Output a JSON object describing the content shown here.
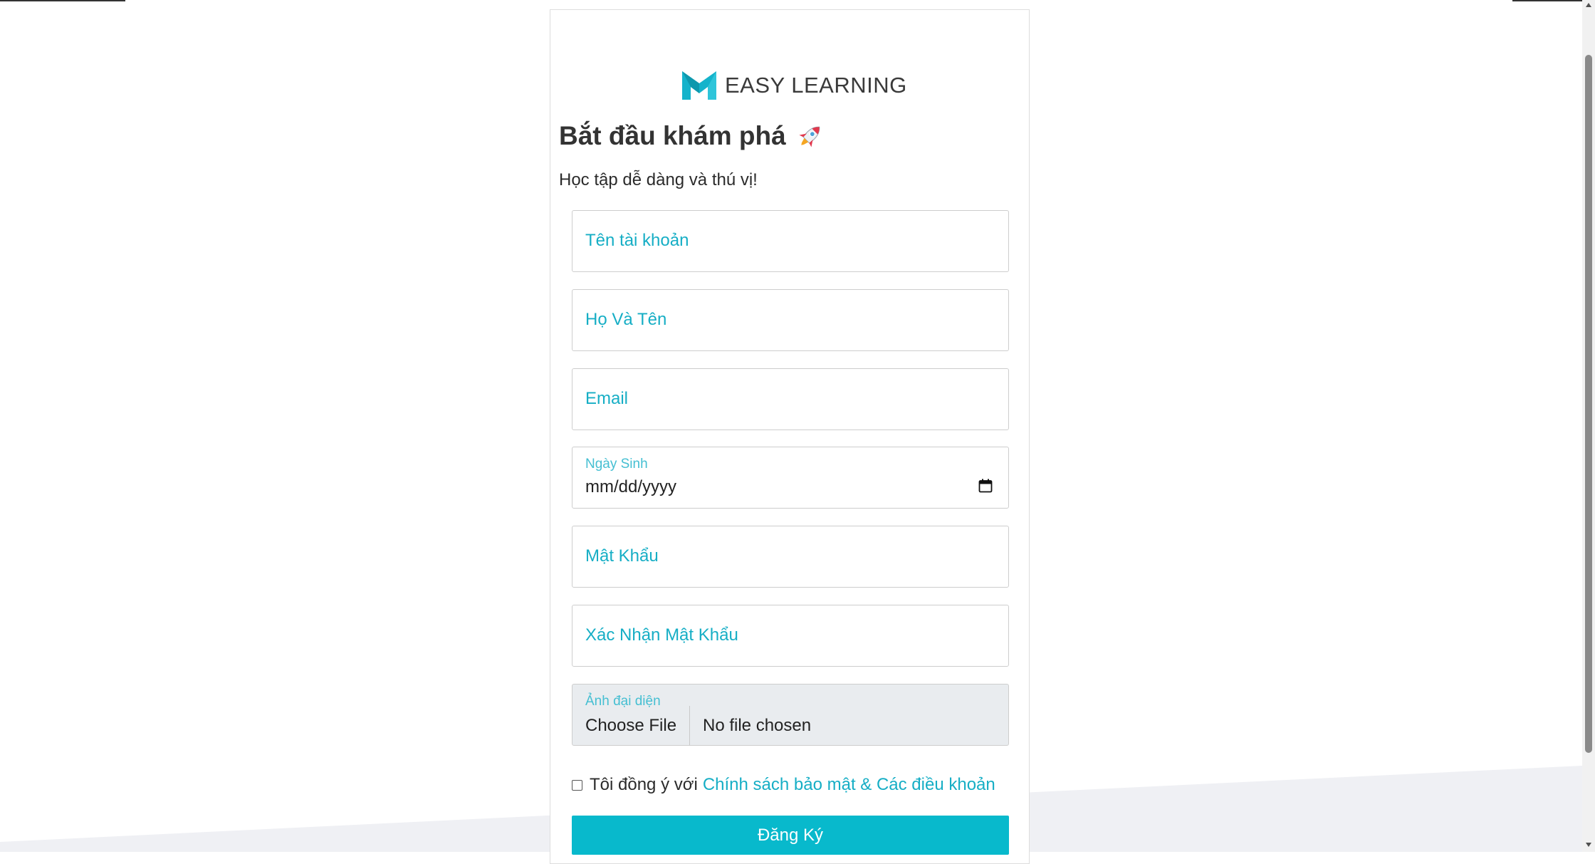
{
  "brand": {
    "name": "EASY LEARNING",
    "logo_icon": "m-logo-icon",
    "accent_color": "#08b9cc"
  },
  "heading": {
    "title": "Bắt đầu khám phá",
    "title_icon": "rocket-icon",
    "subtitle": "Học tập dễ dàng và thú vị!"
  },
  "form": {
    "username": {
      "placeholder": "Tên tài khoản"
    },
    "fullname": {
      "placeholder": "Họ Và Tên"
    },
    "email": {
      "placeholder": "Email"
    },
    "birthday": {
      "label": "Ngày Sinh",
      "value": "mm/dd/yyyy",
      "icon": "calendar-icon"
    },
    "password": {
      "placeholder": "Mật Khẩu"
    },
    "confirm_password": {
      "placeholder": "Xác Nhận Mật Khẩu"
    },
    "avatar": {
      "label": "Ảnh đại diện",
      "button": "Choose File",
      "status": "No file chosen"
    },
    "agree": {
      "text": "Tôi đồng ý với",
      "link": "Chính sách bảo mật & Các điều khoản",
      "checked": false
    },
    "submit_label": "Đăng Ký"
  }
}
